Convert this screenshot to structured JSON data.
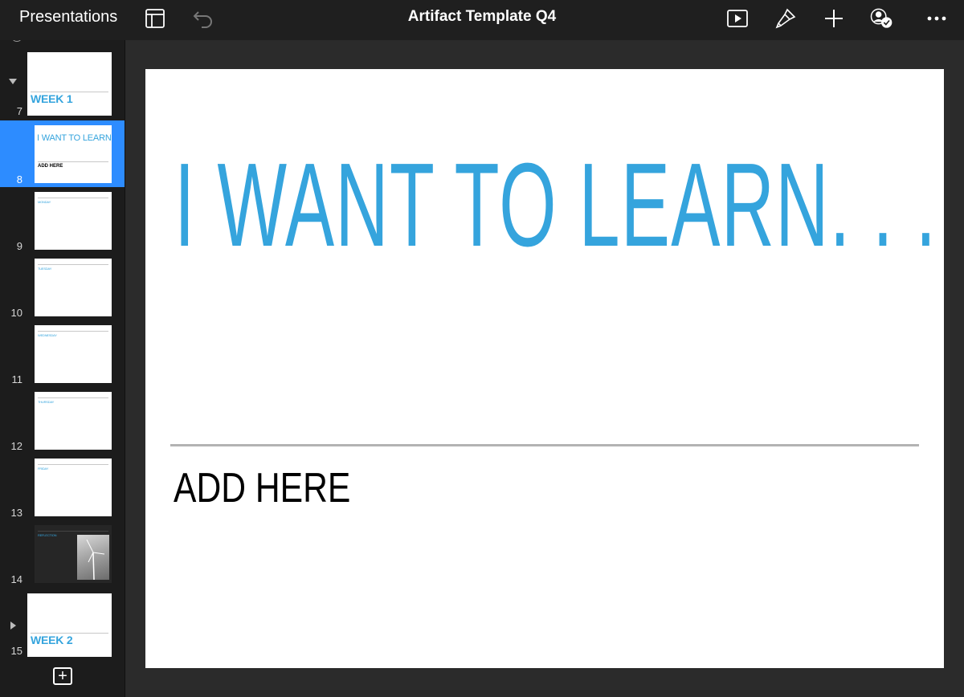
{
  "toolbar": {
    "back_label": "Presentations",
    "title": "Artifact Template Q4",
    "icons": [
      "sidebar-layout-icon",
      "undo-icon",
      "play-icon",
      "format-brush-icon",
      "add-icon",
      "collaborate-icon",
      "more-icon"
    ]
  },
  "sidebar": {
    "slides": [
      {
        "number": "7",
        "type": "section",
        "title": "WEEK 1",
        "chevron": "down"
      },
      {
        "number": "8",
        "type": "slide",
        "title": "I WANT TO LEARN. . .",
        "sub": "ADD HERE",
        "selected": true
      },
      {
        "number": "9",
        "type": "slide",
        "title": "MONDAY"
      },
      {
        "number": "10",
        "type": "slide",
        "title": "TUESDAY"
      },
      {
        "number": "11",
        "type": "slide",
        "title": "WEDNESDAY"
      },
      {
        "number": "12",
        "type": "slide",
        "title": "THURSDAY"
      },
      {
        "number": "13",
        "type": "slide",
        "title": "FRIDAY"
      },
      {
        "number": "14",
        "type": "slide",
        "title": "REFLECTION",
        "dark": true
      },
      {
        "number": "15",
        "type": "section",
        "title": "WEEK 2",
        "chevron": "right"
      }
    ],
    "add_label": "+"
  },
  "slide": {
    "title": "I WANT TO LEARN. . .",
    "subtitle": "ADD HERE",
    "accent_color": "#35a4dd"
  }
}
